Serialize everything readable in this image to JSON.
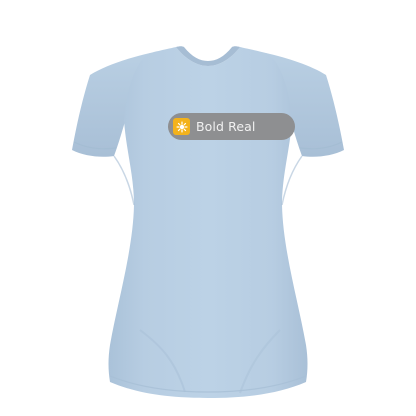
{
  "product": {
    "garment": "t-shirt",
    "garment_color": "#b7cde2",
    "background_color": "#ffffff"
  },
  "print": {
    "text": "Bold Real",
    "pill_color": "#8e8f91",
    "text_color": "#f1f1f1",
    "icon": "sparkle-icon",
    "icon_badge_color": "#f3b21b",
    "icon_color": "#ffffff"
  }
}
